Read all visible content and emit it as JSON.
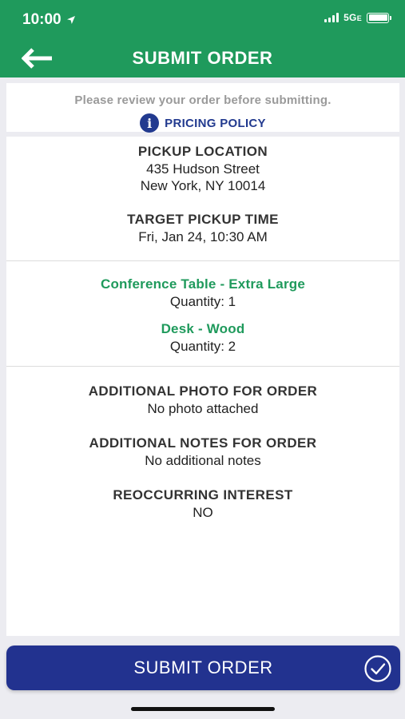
{
  "status_bar": {
    "time": "10:00",
    "network": "5G",
    "network_suffix": "E"
  },
  "header": {
    "title": "SUBMIT ORDER",
    "back_icon": "back-arrow-icon"
  },
  "notice": {
    "text": "Please review your order before submitting.",
    "policy_label": "PRICING POLICY",
    "policy_icon": "info-icon"
  },
  "pickup": {
    "location_label": "PICKUP LOCATION",
    "address_line1": "435 Hudson Street",
    "address_line2": "New York, NY 10014",
    "time_label": "TARGET PICKUP TIME",
    "time_value": "Fri, Jan 24, 10:30 AM"
  },
  "items": [
    {
      "name": "Conference Table - Extra Large",
      "quantity": "Quantity: 1"
    },
    {
      "name": "Desk - Wood",
      "quantity": "Quantity: 2"
    }
  ],
  "extras": {
    "photo_label": "ADDITIONAL PHOTO FOR ORDER",
    "photo_value": "No photo attached",
    "notes_label": "ADDITIONAL NOTES FOR ORDER",
    "notes_value": "No additional notes",
    "reoccurring_label": "REOCCURRING INTEREST",
    "reoccurring_value": "NO"
  },
  "submit_button": {
    "label": "SUBMIT ORDER",
    "icon": "check-circle-icon"
  },
  "colors": {
    "header_green": "#1f9a5c",
    "item_green": "#1f9a5c",
    "navy": "#22328f",
    "background": "#ececf1"
  }
}
